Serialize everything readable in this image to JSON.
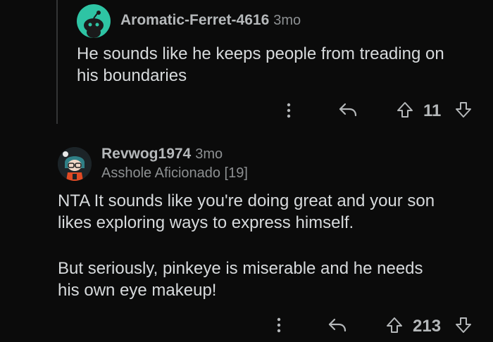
{
  "comments": [
    {
      "username": "Aromatic-Ferret-4616",
      "time": "3mo",
      "body": [
        "He sounds like he keeps people from treading on",
        "his boundaries"
      ],
      "score": "11",
      "avatar_icon": "snoo-avatar-icon",
      "avatar_color": "#2ec4a4"
    },
    {
      "username": "Revwog1974",
      "time": "3mo",
      "flair": "Asshole Aficionado [19]",
      "body": [
        "NTA It sounds like you're doing great and your son",
        "likes exploring ways to express himself.",
        "But seriously, pinkeye is miserable and he needs",
        "his own eye makeup!"
      ],
      "score": "213",
      "avatar_icon": "custom-avatar-icon"
    }
  ],
  "icons": {
    "more": "more-options-icon",
    "reply": "reply-icon",
    "upvote": "upvote-arrow-icon",
    "downvote": "downvote-arrow-icon"
  }
}
